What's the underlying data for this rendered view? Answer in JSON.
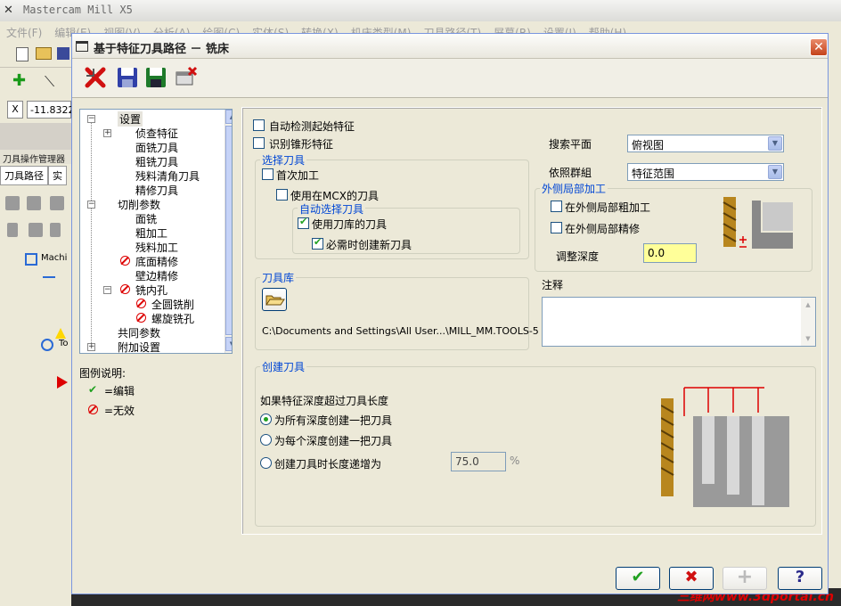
{
  "app": {
    "title": "Mastercam Mill X5",
    "menu": [
      "文件(F)",
      "编辑(E)",
      "视图(V)",
      "分析(A)",
      "绘图(C)",
      "实体(S)",
      "转换(X)",
      "机床类型(M)",
      "刀具路径(T)",
      "屏幕(R)",
      "设置(I)",
      "帮助(H)"
    ],
    "coord_label": "X",
    "coord_value": "-11.8322",
    "manager_title": "刀具操作管理器",
    "manager_tabs": [
      "刀具路径",
      "实"
    ],
    "tree_items": [
      "Machi",
      "To"
    ],
    "watermark": "三维网www.3dportal.cn"
  },
  "dialog": {
    "title": "基于特征刀具路径 － 铣床",
    "close_label": "✕",
    "tree": {
      "items": [
        {
          "label": "设置",
          "expander": "−"
        },
        {
          "label": "侦查特征",
          "expander": "+"
        },
        {
          "label": "面铣刀具"
        },
        {
          "label": "粗铣刀具"
        },
        {
          "label": "残料清角刀具"
        },
        {
          "label": "精修刀具"
        },
        {
          "label": "切削参数",
          "expander": "−"
        },
        {
          "label": "面铣"
        },
        {
          "label": "粗加工"
        },
        {
          "label": "残料加工"
        },
        {
          "label": "底面精修",
          "invalid": true
        },
        {
          "label": "壁边精修"
        },
        {
          "label": "铣内孔",
          "invalid": true,
          "expander": "−"
        },
        {
          "label": "全圆铣削",
          "invalid": true
        },
        {
          "label": "螺旋铣孔",
          "invalid": true
        },
        {
          "label": "共同参数"
        },
        {
          "label": "附加设置",
          "expander": "+"
        }
      ]
    },
    "legend": {
      "title": "图例说明:",
      "edit": "=编辑",
      "invalid": "=无效"
    },
    "main": {
      "auto_detect_label": "自动检测起始特征",
      "recognize_taper_label": "识别锥形特征",
      "select_tool_group": "选择刀具",
      "first_machining_label": "首次加工",
      "use_mcx_tools_label": "使用在MCX的刀具",
      "auto_select_group": "自动选择刀具",
      "use_library_label": "使用刀库的刀具",
      "create_new_label": "必需时创建新刀具",
      "search_plane_label": "搜索平面",
      "search_plane_value": "俯视图",
      "reference_group_label": "依照群組",
      "reference_group_value": "特征范围",
      "outer_group": "外侧局部加工",
      "outer_rough_label": "在外侧局部粗加工",
      "outer_finish_label": "在外侧局部精修",
      "adjust_depth_label": "调整深度",
      "adjust_depth_value": "0.0",
      "library_group": "刀具库",
      "library_path": "C:\\Documents and Settings\\All User...\\MILL_MM.TOOLS-5",
      "notes_label": "注释",
      "create_group": "创建刀具",
      "create_question": "如果特征深度超过刀具长度",
      "radio_each_all": "为所有深度创建一把刀具",
      "radio_each_depth": "为每个深度创建一把刀具",
      "radio_increment": "创建刀具时长度递增为",
      "increment_value": "75.0",
      "percent": "%"
    },
    "buttons": {
      "ok": "✔",
      "cancel": "✖",
      "add": "+",
      "help": "?"
    }
  },
  "colors": {
    "accent": "#0046d5",
    "check": "#21a121",
    "invalid": "#dd0000",
    "highlight_input": "#ffff99"
  }
}
